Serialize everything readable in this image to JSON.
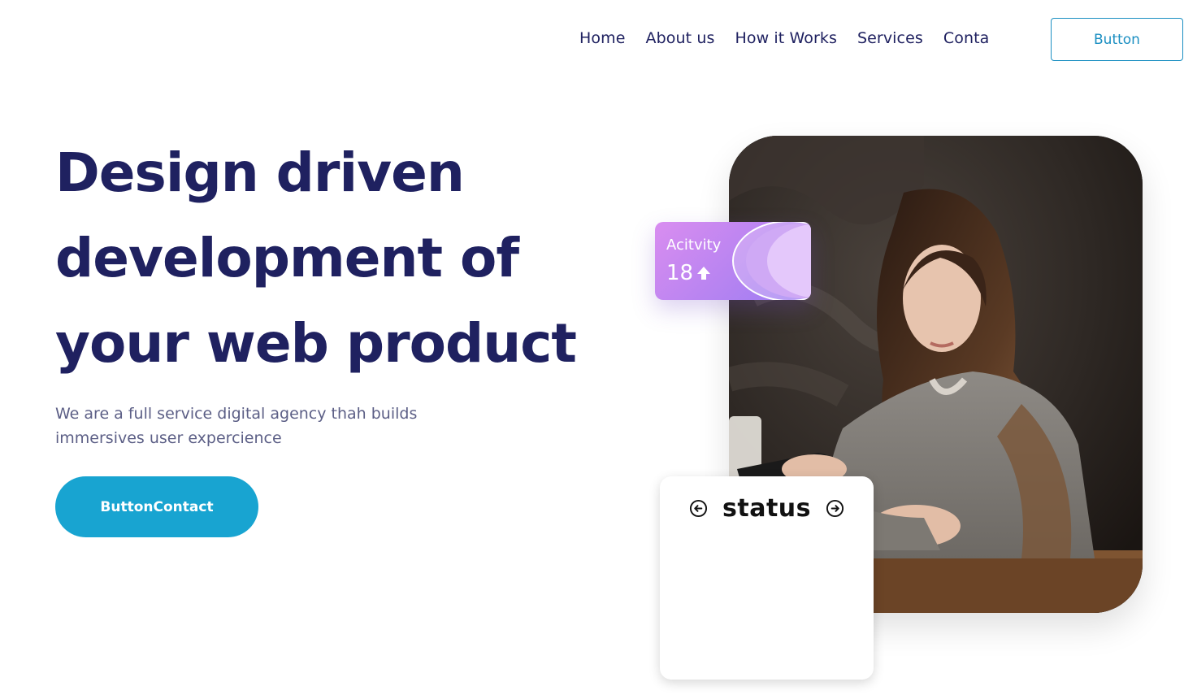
{
  "nav": {
    "items": [
      "Home",
      "About us",
      "How it Works",
      "Services",
      "Conta"
    ],
    "button_label": "Button"
  },
  "hero": {
    "title_lines": [
      "Design driven",
      "development of",
      "your web product"
    ],
    "subtitle_lines": [
      "We are a full service digital agency thah builds",
      "immersives user expercience"
    ],
    "cta_label": "ButtonContact"
  },
  "activity_card": {
    "label": "Acitvity",
    "value": "18",
    "trend_icon": "arrow-up-icon"
  },
  "status_card": {
    "title": "status",
    "prev_icon": "arrow-left-circle-icon",
    "next_icon": "arrow-right-circle-icon"
  },
  "photo": {
    "subject": "woman-with-phone-photo"
  },
  "colors": {
    "heading": "#1f2160",
    "text": "#5c5f86",
    "accent": "#18a4d1",
    "outline_button": "#1b8fc2",
    "activity_gradient_start": "#d98df0",
    "activity_gradient_end": "#9b7cf2"
  }
}
